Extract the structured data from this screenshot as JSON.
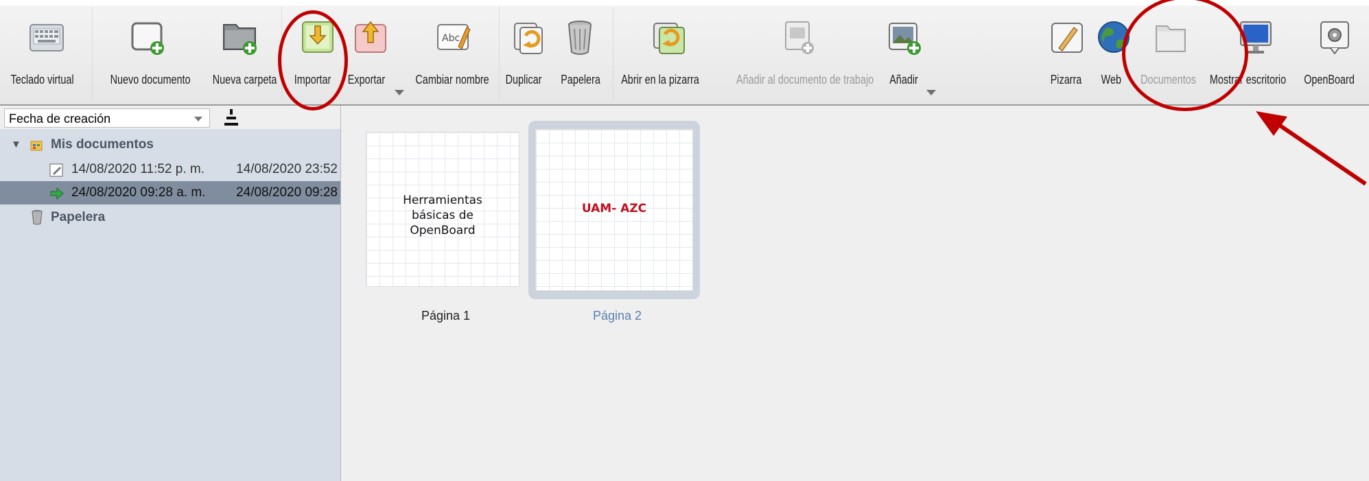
{
  "toolbar": {
    "keyboard": "Teclado virtual",
    "new_document": "Nuevo documento",
    "new_folder": "Nueva carpeta",
    "import": "Importar",
    "export": "Exportar",
    "rename": "Cambiar nombre",
    "duplicate": "Duplicar",
    "trash": "Papelera",
    "open_board": "Abrir en la pizarra",
    "add_to_working": "Añadir al documento de trabajo",
    "add": "Añadir",
    "board": "Pizarra",
    "web": "Web",
    "documents": "Documentos",
    "show_desktop": "Mostrar escritorio",
    "openboard": "OpenBoard"
  },
  "sidebar": {
    "sort_select": "Fecha de creación",
    "tree": {
      "my_documents": "Mis documentos",
      "items": [
        {
          "name": "14/08/2020 11:52 p. m.",
          "date": "14/08/2020 23:52"
        },
        {
          "name": "24/08/2020 09:28 a. m.",
          "date": "24/08/2020 09:28"
        }
      ],
      "trash": "Papelera"
    }
  },
  "pages": [
    {
      "text": "Herramientas básicas de OpenBoard",
      "label": "Página 1"
    },
    {
      "text": "UAM- AZC",
      "label": "Página 2"
    }
  ],
  "colors": {
    "accent_red": "#c00000",
    "selection": "#7f8d9e"
  }
}
